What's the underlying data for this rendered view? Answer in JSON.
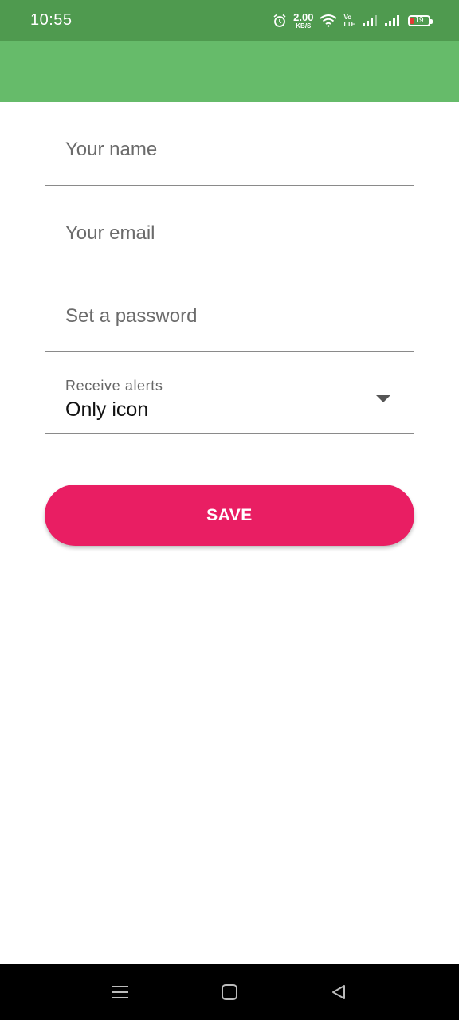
{
  "status_bar": {
    "time": "10:55",
    "net_speed_value": "2.00",
    "net_speed_unit": "KB/S",
    "volte_top": "Vo",
    "volte_bottom": "LTE",
    "battery_level": "19",
    "colors": {
      "background": "#4f9a4f",
      "battery_low": "#e53935"
    },
    "icons": [
      "alarm-icon",
      "wifi-icon",
      "volte-icon",
      "signal-icon",
      "signal-icon",
      "battery-icon"
    ]
  },
  "app_bar": {
    "color": "#66bb6a"
  },
  "form": {
    "name_placeholder": "Your name",
    "email_placeholder": "Your email",
    "password_placeholder": "Set a password",
    "alerts": {
      "label": "Receive alerts",
      "selected_value": "Only icon"
    },
    "save_label": "SAVE",
    "save_color": "#e91e63"
  },
  "nav_bar": {
    "icons": [
      "menu-icon",
      "home-icon",
      "back-icon"
    ]
  }
}
